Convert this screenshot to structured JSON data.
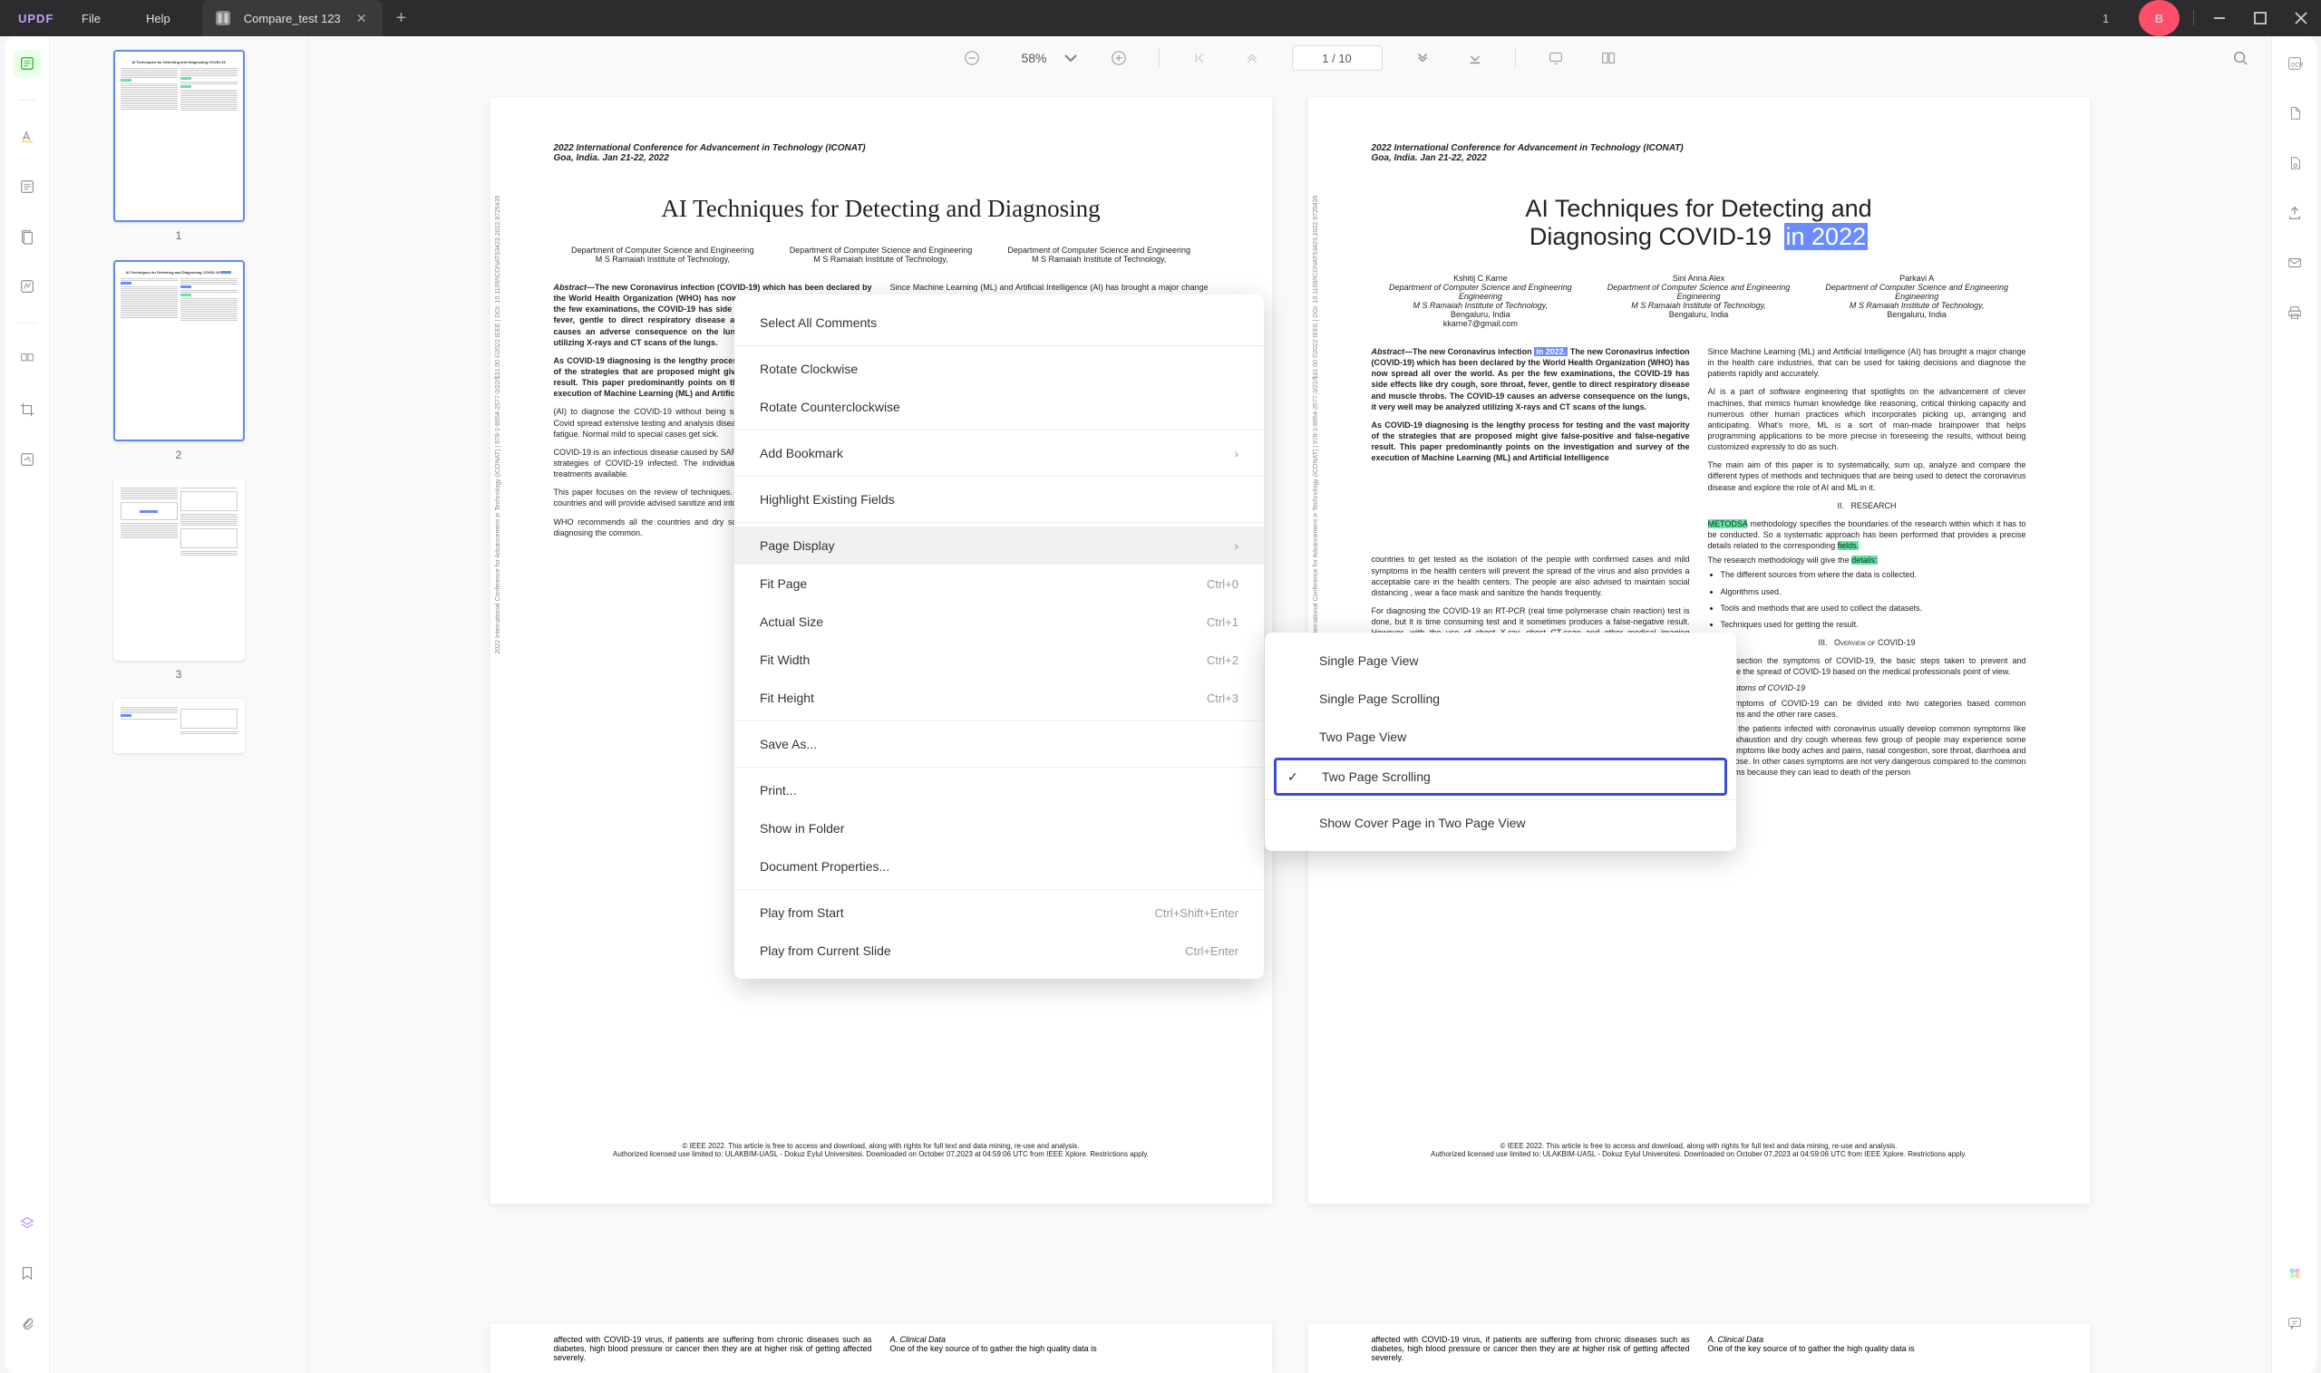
{
  "app": {
    "logo_text": "UPDF",
    "menu": {
      "file": "File",
      "help": "Help"
    },
    "tab_title": "Compare_test 123",
    "window_count": "1",
    "avatar_letter": "B"
  },
  "toolbar": {
    "zoom": "58%",
    "page_current": "1",
    "page_sep": "/",
    "page_total": "10"
  },
  "thumbnails": [
    {
      "label": "1"
    },
    {
      "label": "2"
    },
    {
      "label": "3"
    }
  ],
  "context_menu": {
    "select_all": "Select All Comments",
    "rotate_cw": "Rotate Clockwise",
    "rotate_ccw": "Rotate Counterclockwise",
    "add_bookmark": "Add Bookmark",
    "highlight_fields": "Highlight Existing Fields",
    "page_display": "Page Display",
    "fit_page": "Fit Page",
    "fit_page_sc": "Ctrl+0",
    "actual_size": "Actual Size",
    "actual_size_sc": "Ctrl+1",
    "fit_width": "Fit Width",
    "fit_width_sc": "Ctrl+2",
    "fit_height": "Fit Height",
    "fit_height_sc": "Ctrl+3",
    "save_as": "Save As...",
    "print": "Print...",
    "show_in_folder": "Show in Folder",
    "doc_props": "Document Properties...",
    "play_start": "Play from Start",
    "play_start_sc": "Ctrl+Shift+Enter",
    "play_current": "Play from Current Slide",
    "play_current_sc": "Ctrl+Enter"
  },
  "submenu": {
    "single_view": "Single Page View",
    "single_scroll": "Single Page Scrolling",
    "two_view": "Two Page View",
    "two_scroll": "Two Page Scrolling",
    "cover": "Show Cover Page in Two Page View"
  },
  "doc": {
    "conf_line1": "2022 International Conference for Advancement in Technology (ICONAT)",
    "conf_line2": "Goa, India. Jan 21-22, 2022",
    "title_left": "AI Techniques for Detecting and Diagnosing",
    "title_right_a": "AI Techniques for Detecting and",
    "title_right_b": "Diagnosing COVID-19",
    "title_right_hl": "in 2022",
    "authors": [
      {
        "name": "Kshitij C Karne",
        "dept": "Department of Computer Science and Engineering",
        "inst": "M S Ramaiah Institute of Technology,",
        "loc": "Bengaluru, India",
        "email": "kkarne7@gmail.com"
      },
      {
        "name": "Sini Anna Alex",
        "dept": "Department of Computer Science and Engineering",
        "inst": "M S Ramaiah Institute of Technology,",
        "loc": "Bengaluru, India",
        "email": ""
      },
      {
        "name": "Parkavi A",
        "dept": "Department of Computer Science and Engineering",
        "inst": "M S Ramaiah Institute of Technology,",
        "loc": "Bengaluru, India",
        "email": ""
      }
    ],
    "abstract_label": "Abstract—",
    "abstract_text": "The new Coronavirus infection (COVID-19) which has been declared by the World Health Organization (WHO) has now spread all over the world. As per the few examinations, the COVID-19 has side effects like dry cough, sore throat, fever, gentle to direct respiratory disease and muscle throbs. The COVID-19 causes an adverse consequence on the lungs, it very well may be analyzed utilizing X-rays and CT scans of the lungs.",
    "abstract_hl": "in 2022.",
    "para2": "As COVID-19 diagnosing is the lengthy process for testing and the vast majority of the strategies that are proposed might give false-positive and false-negative result. This paper predominantly points on the investigation and survey of the execution of Machine Learning (ML) and Artificial Intelligence",
    "col2_p1": "Since Machine Learning (ML) and Artificial Intelligence (AI) has brought a major change in the health care industries, that can be used for taking decisions and diagnose the patients rapidly and accurately.",
    "col2_p2": "AI is a part of software engineering that spotlights on the advancement of clever machines, that mimics human knowledge like reasoning, critical thinking capacity and numerous other human practices which incorporates picking up, arranging and anticipating. What's more, ML is a sort of man-made brainpower that helps programming applications to be more precise in foreseeing the results, without being customized expressly to do as such.",
    "col2_p3": "The main aim of this paper is to systematically, sum up, analyze and compare the different types of methods and techniques that are being used to detect the coronavirus disease and explore the role of AI and ML in it.",
    "sec2_num": "II.",
    "sec2": "RESEARCH",
    "sec2_hl": "METODSA",
    "sec2_tail": "methodology specifies the boundaries of the research within which it has to be conducted. So a systematic approach has been performed that provides a precise details related to the corresponding ",
    "sec2_hl2": "fields.",
    "sec2_l1a": "The research methodology will give the ",
    "sec2_l1b": "details:",
    "sec2_l2": "The different sources from where the data is collected.",
    "sec2_l3": "Algorithms used.",
    "sec2_l4": "Tools and methods that are used to collect the datasets.",
    "sec2_l5": "Techniques used for getting the result.",
    "sec3_num": "III.",
    "sec3": "Overview of COVID-19",
    "sec3_p1": "In this section the symptoms of COVID-19, the basic steps taken to prevent and diagnose the spread of COVID-19 based on the medical professionals point of view.",
    "sec3_a": "A. Symptoms of COVID-19",
    "sec3_p2": "The symptoms of COVID-19 can be divided into two categories based common symptoms and the other rare cases.",
    "sec3_p3": "Most of the patients infected with coronavirus usually develop common symptoms like fever, exhaustion and dry cough whereas few group of people may experience some extra symptoms like body aches and pains, nasal congestion, sore throat, diarrhoea and runny nose. In other cases symptoms are not very dangerous compared to the common symptoms because they can lead to death of the person",
    "left_p3": "countries to get tested as the isolation of the people with confirmed cases and mild symptoms in the health centers will prevent the spread of the virus and also provides a acceptable care in the health centers. The people are also advised to maintain social distancing , wear a face mask and sanitize the hands frequently.",
    "left_p4": "For diagnosing the COVID-19 an RT-PCR (real time polymerase chain reaction) test is done, but it is time consuming test and it sometimes produces a false-negative result. However, with the use of chest X-ray, chest CT-scan and other medical imaging techniques can play a crucial role in diagnosing the COVID-19.",
    "footnote": "© IEEE 2022. This article is free to access and download, along with rights for full text and data mining, re-use and analysis.\nAuthorized licensed use limited to: ULAKBIM-UASL - Dokuz Eylul Universitesi. Downloaded on October 07,2023 at 04:59:06 UTC from IEEE Xplore. Restrictions apply.",
    "vertical_text": "2022 International Conference for Advancement in Technology (ICONAT) | 978-1-6654-2577-3/22/$31.00 ©2022 IEEE | DOI: 10.1109/ICONAT53423.2022.9725435",
    "bottom_left": "affected with COVID-19 virus, if patients are suffering from chronic diseases such as diabetes, high blood pressure or cancer then they are at higher risk of getting affected severely.",
    "bottom_right_a": "A. Clinical Data",
    "bottom_right_p": "One of the key source of to gather the high quality data is"
  }
}
